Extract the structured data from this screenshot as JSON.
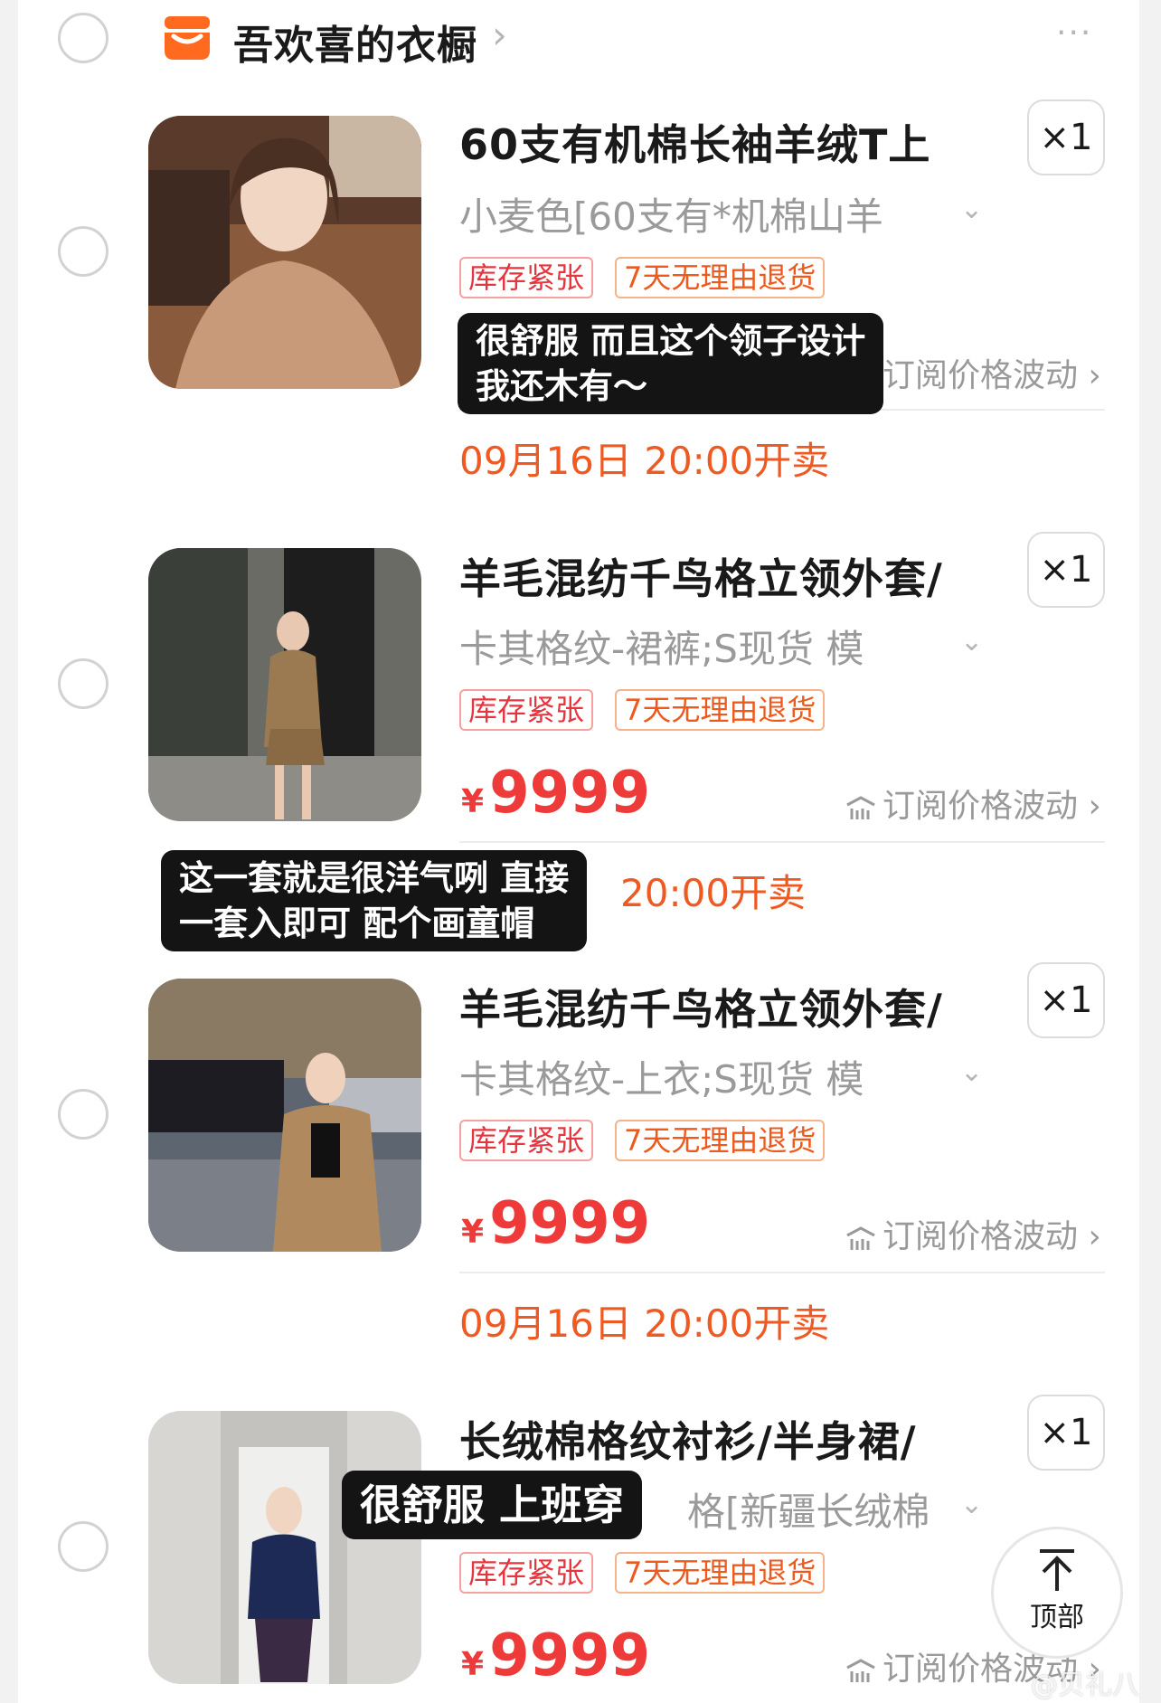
{
  "shop": {
    "name": "吾欢喜的衣橱",
    "chevron": "›",
    "more": "···"
  },
  "items": [
    {
      "title": "60支有机棉长袖羊绒T上",
      "quantity": "×1",
      "variant": "小麦色[60支有*机棉山羊",
      "tags": [
        "库存紧张",
        "7天无理由退货"
      ],
      "subscribe": "订阅价格波动",
      "sale_time": "09月16日 20:00开卖"
    },
    {
      "title": "羊毛混纺千鸟格立领外套/",
      "quantity": "×1",
      "variant": "卡其格纹-裙裤;S现货  模",
      "tags": [
        "库存紧张",
        "7天无理由退货"
      ],
      "currency": "¥",
      "price": "9999",
      "subscribe": "订阅价格波动",
      "sale_time": "20:00开卖"
    },
    {
      "title": "羊毛混纺千鸟格立领外套/",
      "quantity": "×1",
      "variant": "卡其格纹-上衣;S现货  模",
      "tags": [
        "库存紧张",
        "7天无理由退货"
      ],
      "currency": "¥",
      "price": "9999",
      "subscribe": "订阅价格波动",
      "sale_time": "09月16日 20:00开卖"
    },
    {
      "title": "长绒棉格纹衬衫/半身裙/",
      "quantity": "×1",
      "variant": "格[新疆长绒棉",
      "tags": [
        "库存紧张",
        "7天无理由退货"
      ],
      "currency": "¥",
      "price": "9999",
      "subscribe": "订阅价格波动"
    }
  ],
  "captions": {
    "c1_line1": "很舒服 而且这个领子设计",
    "c1_line2": "我还木有～",
    "c2_line1": "这一套就是很洋气咧 直接",
    "c2_line2": "一套入即可 配个画童帽",
    "c3": "很舒服 上班穿"
  },
  "top_button": {
    "label": "顶部"
  },
  "watermark": "@贝礼八",
  "colors": {
    "price": "#ef3a3a",
    "accent": "#ef5a22",
    "tag_red": "#e8343f",
    "tag_orange": "#ee5a1d"
  }
}
